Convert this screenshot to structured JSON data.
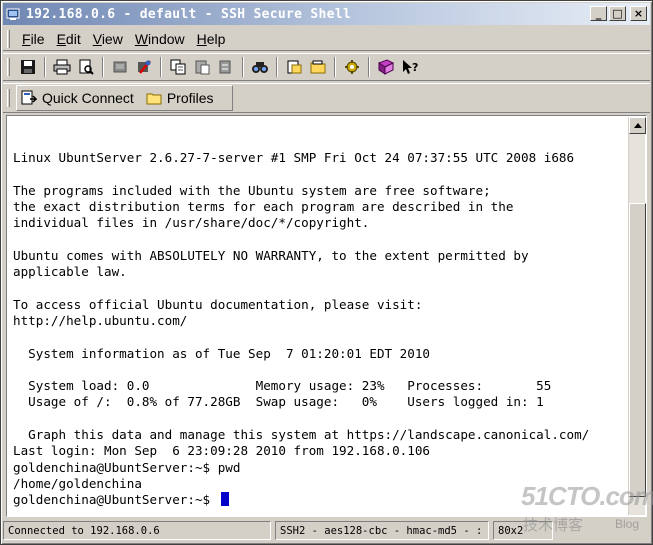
{
  "window": {
    "title": "192.168.0.6 - default - SSH Secure Shell",
    "minimize": "_",
    "maximize": "□",
    "close": "×"
  },
  "menu": {
    "items": [
      {
        "label": "File",
        "u": "F",
        "rest": "ile"
      },
      {
        "label": "Edit",
        "u": "E",
        "rest": "dit"
      },
      {
        "label": "View",
        "u": "V",
        "rest": "iew"
      },
      {
        "label": "Window",
        "u": "W",
        "rest": "indow"
      },
      {
        "label": "Help",
        "u": "H",
        "rest": "elp"
      }
    ]
  },
  "toolbar": {
    "icons": [
      "save-icon",
      "print-icon",
      "print-preview-icon",
      "new-terminal-icon",
      "disconnect-icon",
      "copy-icon",
      "paste-icon",
      "paste-special-icon",
      "find-icon",
      "new-file-transfer-icon",
      "folder-icon",
      "settings-icon",
      "help-book-icon",
      "context-help-icon"
    ]
  },
  "profilebar": {
    "quick_connect": "Quick Connect",
    "profiles": "Profiles"
  },
  "terminal": {
    "lines": [
      "Linux UbuntServer 2.6.27-7-server #1 SMP Fri Oct 24 07:37:55 UTC 2008 i686",
      "",
      "The programs included with the Ubuntu system are free software;",
      "the exact distribution terms for each program are described in the",
      "individual files in /usr/share/doc/*/copyright.",
      "",
      "Ubuntu comes with ABSOLUTELY NO WARRANTY, to the extent permitted by",
      "applicable law.",
      "",
      "To access official Ubuntu documentation, please visit:",
      "http://help.ubuntu.com/",
      "",
      "  System information as of Tue Sep  7 01:20:01 EDT 2010",
      "",
      "  System load: 0.0              Memory usage: 23%   Processes:       55",
      "  Usage of /:  0.8% of 77.28GB  Swap usage:   0%    Users logged in: 1",
      "",
      "  Graph this data and manage this system at https://landscape.canonical.com/",
      "Last login: Mon Sep  6 23:09:28 2010 from 192.168.0.106",
      "goldenchina@UbuntServer:~$ pwd",
      "/home/goldenchina",
      "goldenchina@UbuntServer:~$ "
    ]
  },
  "status": {
    "connection": "Connected to 192.168.0.6",
    "cipher": "SSH2 - aes128-cbc - hmac-md5 - :",
    "size": "80x2"
  },
  "watermark": {
    "logo": "51CTO.com",
    "subtitle": "技术博客",
    "blog": "Blog"
  }
}
